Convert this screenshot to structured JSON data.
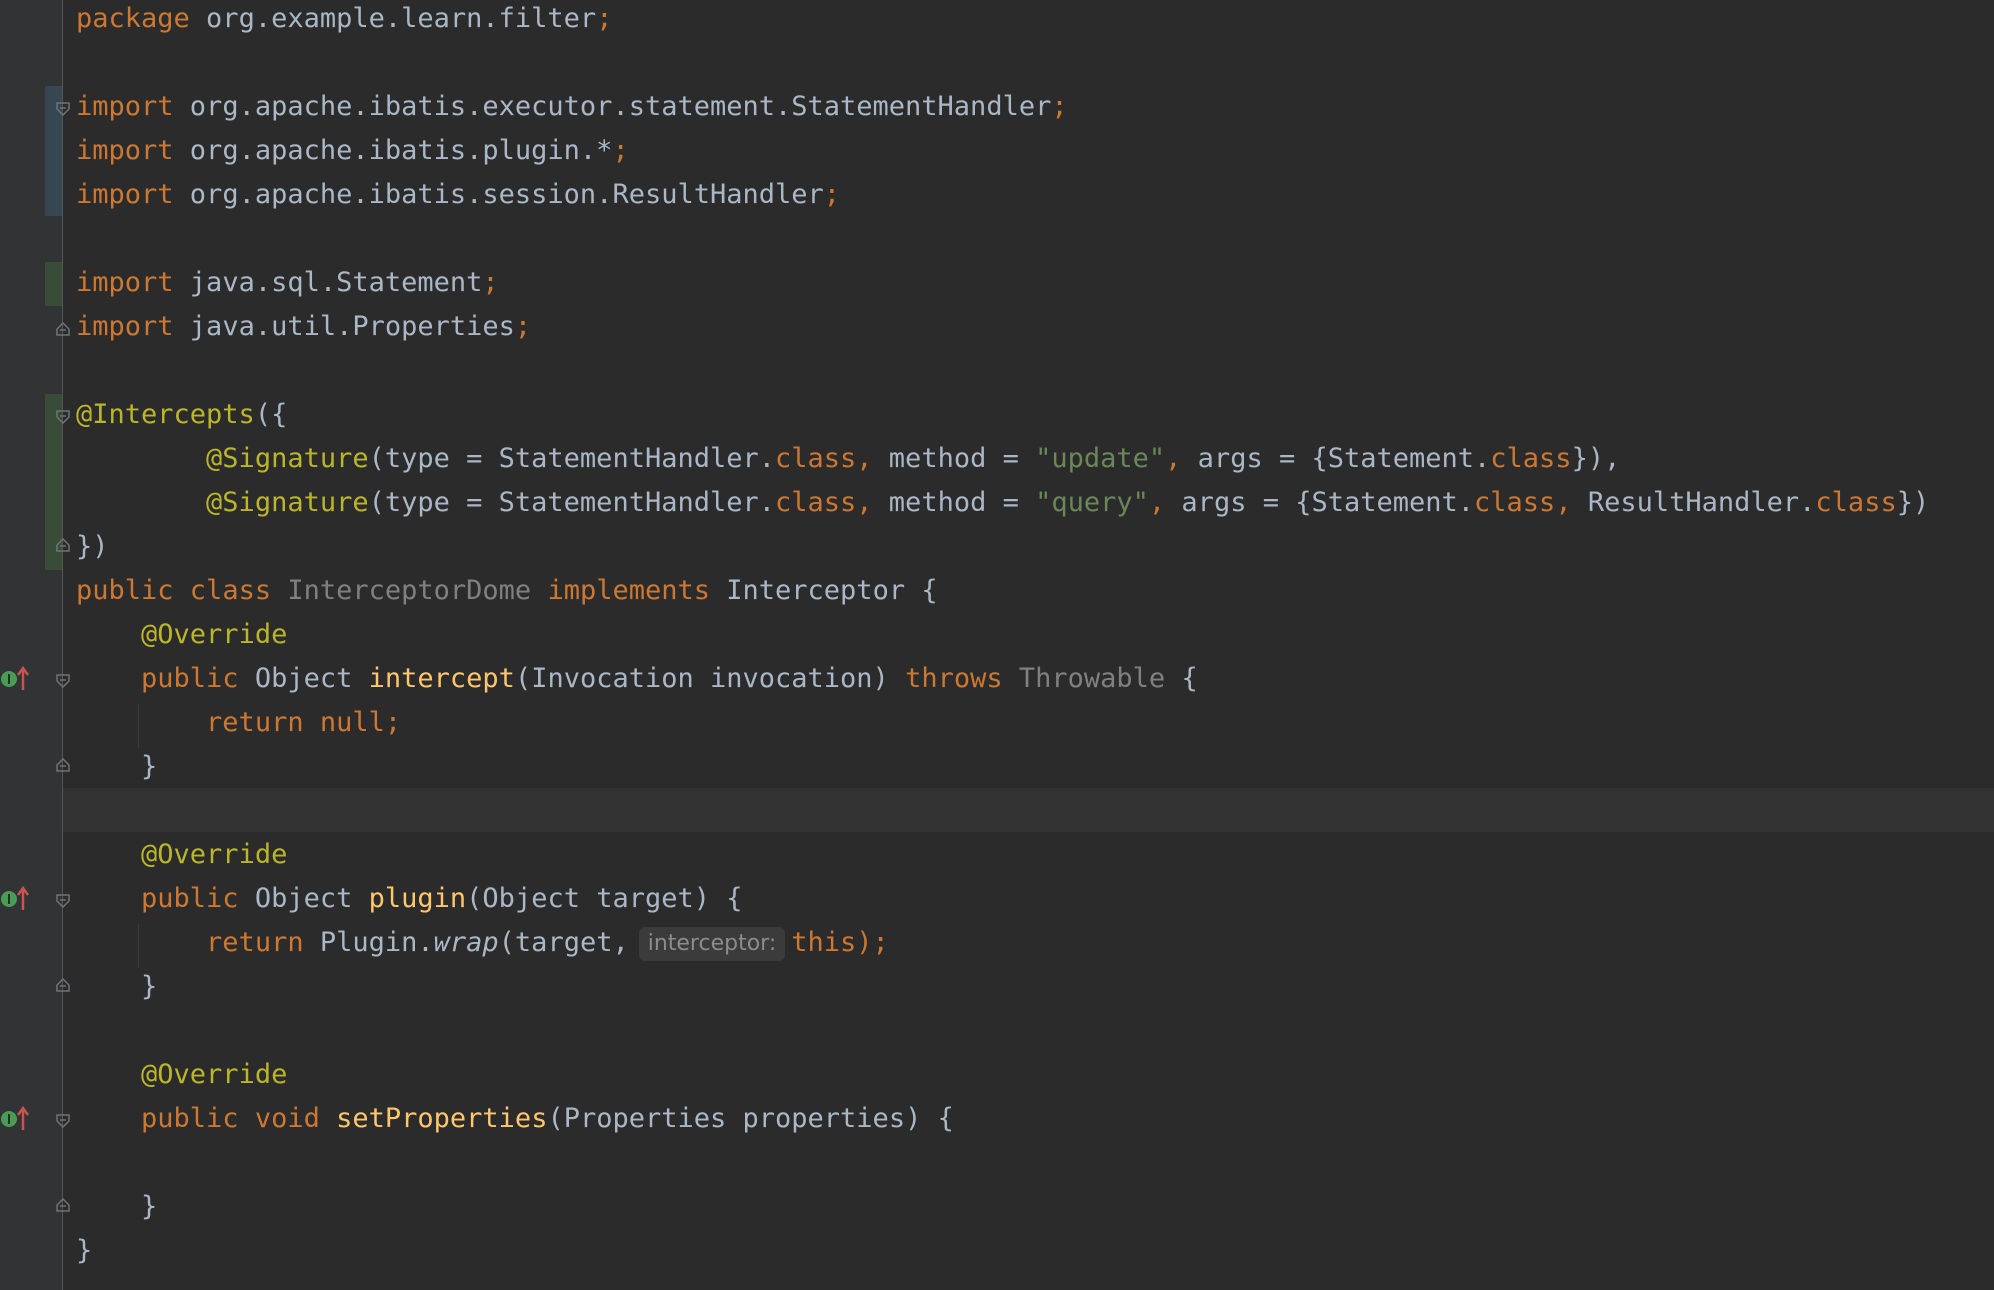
{
  "editor": {
    "lines": {
      "l1_kw": "package",
      "l1_rest": " org.example.learn.filter",
      "semi": ";",
      "import_kw": "import",
      "l3_rest": " org.apache.ibatis.executor.statement.StatementHandler",
      "l4_rest": " org.apache.ibatis.plugin.*",
      "l5_rest": " org.apache.ibatis.session.ResultHandler",
      "l7_rest": " java.sql.Statement",
      "l8_rest": " java.util.Properties",
      "intercepts": "@Intercepts",
      "open_brace_paren": "({",
      "signature": "@Signature",
      "sig_type": "(type = StatementHandler.",
      "class_kw": "class",
      "comma": ",",
      "sig_method": " method = ",
      "update_str": "\"update\"",
      "query_str": "\"query\"",
      "sig_args": " args = {Statement.",
      "sig_close1": "}),",
      "result_handler": " ResultHandler.",
      "sig_close2": "})",
      "close_brace_paren": "})",
      "public_kw": "public",
      "class_word": " class ",
      "class_name": "InterceptorDome",
      "implements_kw": " implements ",
      "interceptor": "Interceptor {",
      "override": "@Override",
      "object_type": " Object ",
      "intercept_fn": "intercept",
      "intercept_params": "(Invocation invocation) ",
      "throws_kw": "throws",
      "throwable": " Throwable",
      "open_brace": " {",
      "return_kw": "return",
      "null_kw": " null;",
      "close_brace": "}",
      "plugin_fn": "plugin",
      "plugin_params": "(Object target) {",
      "plugin_wrap_pre": " Plugin.",
      "wrap_fn": "wrap",
      "wrap_args": "(target,",
      "hint_interceptor": "interceptor:",
      "this_kw": "this",
      "wrap_close": ");",
      "void_kw": " void ",
      "setprops_fn": "setProperties",
      "setprops_params": "(Properties properties) {"
    }
  },
  "colors": {
    "background": "#2b2b2b",
    "keyword": "#cc7832",
    "annotation": "#bbb529",
    "function": "#ffc66d",
    "string": "#6a8759",
    "text": "#a9b7c6",
    "unused": "#808080"
  },
  "icons": {
    "implements_marker": "implementing-method-icon",
    "fold_marker": "fold-arrow-icon"
  }
}
